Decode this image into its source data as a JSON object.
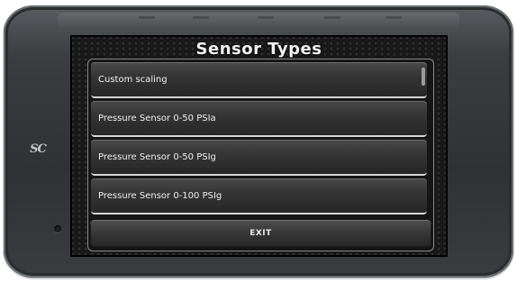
{
  "screen": {
    "title": "Sensor Types"
  },
  "device": {
    "logo_text": "SC"
  },
  "list": {
    "items": [
      {
        "label": "Custom scaling"
      },
      {
        "label": "Pressure Sensor 0-50 PSIa"
      },
      {
        "label": "Pressure Sensor 0-50 PSIg"
      },
      {
        "label": "Pressure Sensor 0-100 PSIg"
      }
    ]
  },
  "footer": {
    "exit_label": "EXIT"
  }
}
